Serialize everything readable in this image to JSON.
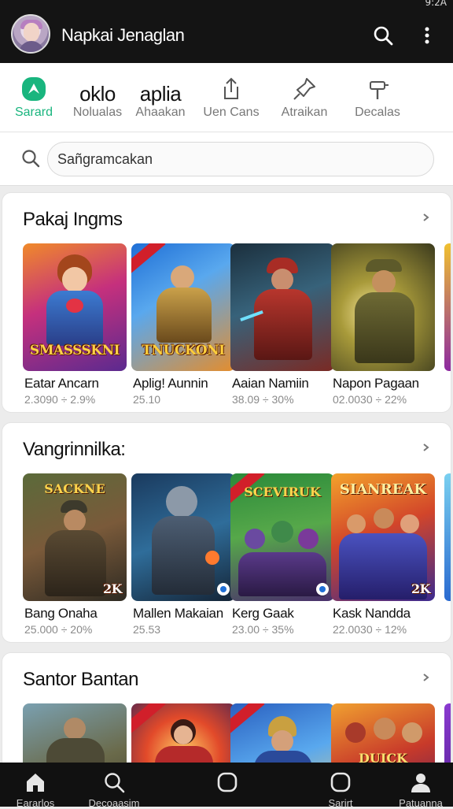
{
  "status": {
    "time": "9:2A"
  },
  "appbar": {
    "title": "Napkai Jenaglan"
  },
  "categories": [
    {
      "big": "",
      "label": "Sarard",
      "icon": "app-logo-icon",
      "active": true
    },
    {
      "big": "oklo",
      "label": "Nolualas",
      "icon": ""
    },
    {
      "big": "aplia",
      "label": "Ahaakan",
      "icon": ""
    },
    {
      "big": "",
      "label": "Uen Cans",
      "icon": "share-icon"
    },
    {
      "big": "",
      "label": "Atraikan",
      "icon": "pin-icon"
    },
    {
      "big": "",
      "label": "Decalas",
      "icon": "hammer-icon"
    }
  ],
  "search": {
    "placeholder": "Sañgramcakan"
  },
  "sections": [
    {
      "title": "Pakaj Ingms",
      "items": [
        {
          "name": "Eatar Ancarn",
          "meta": "2.3090 ÷ 2.9%",
          "logo": "SMASSSKNI",
          "toplogo": ""
        },
        {
          "name": "Aplig! Aunnin",
          "meta": "25.10",
          "logo": "TNUCKONI",
          "toplogo": ""
        },
        {
          "name": "Aaian Namiin",
          "meta": "38.09 ÷ 30%",
          "logo": "",
          "toplogo": ""
        },
        {
          "name": "Napon Pagaan",
          "meta": "02.0030 ÷ 22%",
          "logo": "",
          "toplogo": ""
        }
      ]
    },
    {
      "title": "Vangrinnilka:",
      "items": [
        {
          "name": "Bang Onaha",
          "meta": "25.000 ÷ 20%",
          "logo": "2K",
          "toplogo": "SACKNE"
        },
        {
          "name": "Mallen Makaian",
          "meta": "25.53",
          "logo": "",
          "toplogo": ""
        },
        {
          "name": "Kerg Gaak",
          "meta": "23.00 ÷ 35%",
          "logo": "",
          "toplogo": "SCEVIRUK"
        },
        {
          "name": "Kask Nandda",
          "meta": "22.0030 ÷ 12%",
          "logo": "2K",
          "toplogo": "SIANREAK"
        }
      ]
    },
    {
      "title": "Santor Bantan",
      "items": [
        {
          "name": "",
          "meta": "",
          "logo": "",
          "toplogo": ""
        },
        {
          "name": "",
          "meta": "",
          "logo": "",
          "toplogo": ""
        },
        {
          "name": "",
          "meta": "",
          "logo": "",
          "toplogo": ""
        },
        {
          "name": "",
          "meta": "",
          "logo": "DUICK",
          "toplogo": ""
        }
      ]
    }
  ],
  "bottom_nav": [
    {
      "label": "Eararlos",
      "icon": "home-icon"
    },
    {
      "label": "Decoaasim",
      "icon": "search-icon"
    },
    {
      "label": "",
      "icon": "square-icon"
    },
    {
      "label": "Sarirt",
      "icon": "square-icon"
    },
    {
      "label": "Patuanna",
      "icon": "profile-icon"
    }
  ],
  "colors": {
    "accent": "#19b57e",
    "appbar": "#141414",
    "background": "#ececec"
  }
}
